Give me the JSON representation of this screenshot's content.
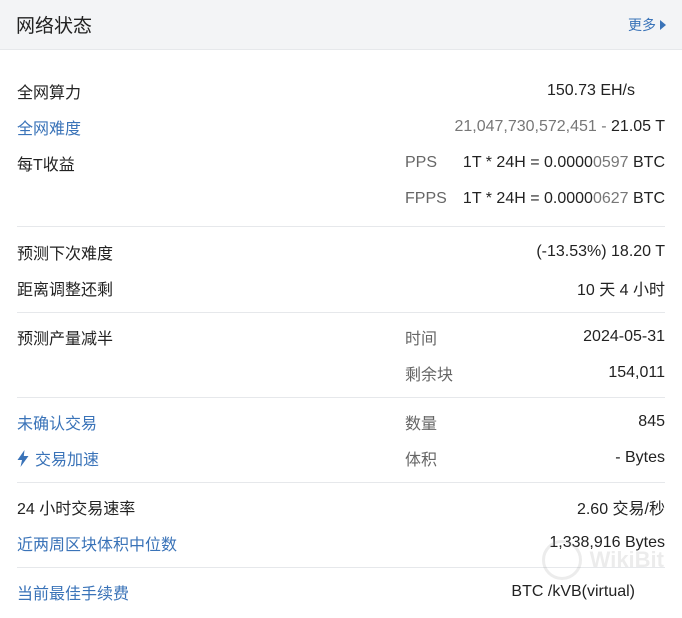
{
  "header": {
    "title": "网络状态",
    "more_label": "更多"
  },
  "hashrate": {
    "label": "全网算力",
    "value": "150.73 EH/s"
  },
  "difficulty": {
    "label": "全网难度",
    "raw": "21,047,730,572,451",
    "dash": " - ",
    "value": "21.05 T"
  },
  "earnings": {
    "label": "每T收益",
    "pps": {
      "name": "PPS",
      "formula": "1T * 24H = 0.0000",
      "digits": "0597",
      "unit": " BTC"
    },
    "fpps": {
      "name": "FPPS",
      "formula": "1T * 24H = 0.0000",
      "digits": "0627",
      "unit": " BTC"
    }
  },
  "next_difficulty": {
    "label": "预测下次难度",
    "value": "(-13.53%) 18.20 T"
  },
  "time_to_adjust": {
    "label": "距离调整还剩",
    "value": "10 天 4 小时"
  },
  "halving": {
    "label": "预测产量减半",
    "time_label": "时间",
    "time_value": "2024-05-31",
    "blocks_label": "剩余块",
    "blocks_value": "154,011"
  },
  "unconfirmed": {
    "label": "未确认交易",
    "count_label": "数量",
    "count_value": "845",
    "accelerate_label": "交易加速",
    "size_label": "体积",
    "size_value": "- Bytes"
  },
  "tx_rate": {
    "label": "24 小时交易速率",
    "value": "2.60 交易/秒"
  },
  "median_block": {
    "label": "近两周区块体积中位数",
    "value": "1,338,916 Bytes"
  },
  "best_fee": {
    "label": "当前最佳手续费",
    "value": "BTC /kVB(virtual)"
  },
  "watermark": {
    "text": "WikiBit"
  },
  "colors": {
    "link": "#3a73b8",
    "header_bg": "#f3f4f6",
    "separator": "#e6e8eb"
  }
}
